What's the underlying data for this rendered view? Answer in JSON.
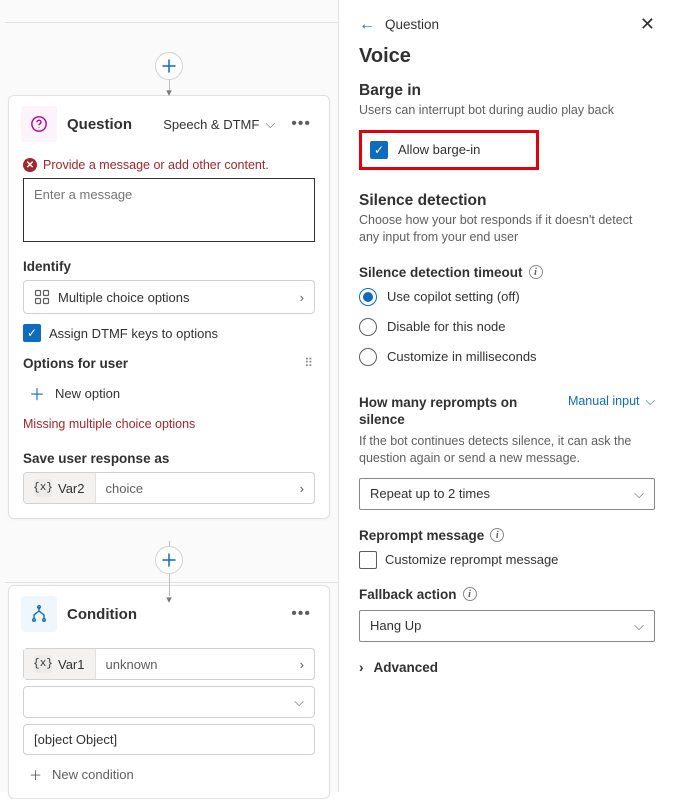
{
  "canvas": {
    "question": {
      "title": "Question",
      "mode": "Speech & DTMF",
      "error": "Provide a message or add other content.",
      "placeholder": "Enter a message",
      "identify_label": "Identify",
      "identify_value": "Multiple choice options",
      "assign_dtmf": "Assign DTMF keys to options",
      "options_label": "Options for user",
      "new_option": "New option",
      "options_error": "Missing multiple choice options",
      "save_label": "Save user response as",
      "var_name": "Var2",
      "var_type": "choice"
    },
    "condition": {
      "title": "Condition",
      "var_name": "Var1",
      "var_type": "unknown",
      "value": "[object Object]",
      "new_condition": "New condition"
    }
  },
  "panel": {
    "breadcrumb": "Question",
    "voice_heading": "Voice",
    "barge": {
      "heading": "Barge in",
      "desc": "Users can interrupt bot during audio play back",
      "checkbox": "Allow barge-in"
    },
    "silence": {
      "heading": "Silence detection",
      "desc": "Choose how your bot responds if it doesn't detect any input from your end user",
      "timeout_label": "Silence detection timeout",
      "opt1": "Use copilot setting (off)",
      "opt2": "Disable for this node",
      "opt3": "Customize in milliseconds"
    },
    "reprompt": {
      "heading": "How many reprompts on silence",
      "manual": "Manual input",
      "desc": "If the bot continues detects silence, it can ask the question again or send a new message.",
      "value": "Repeat up to 2 times",
      "msg_label": "Reprompt message",
      "msg_check": "Customize reprompt message"
    },
    "fallback": {
      "label": "Fallback action",
      "value": "Hang Up"
    },
    "advanced": "Advanced"
  }
}
